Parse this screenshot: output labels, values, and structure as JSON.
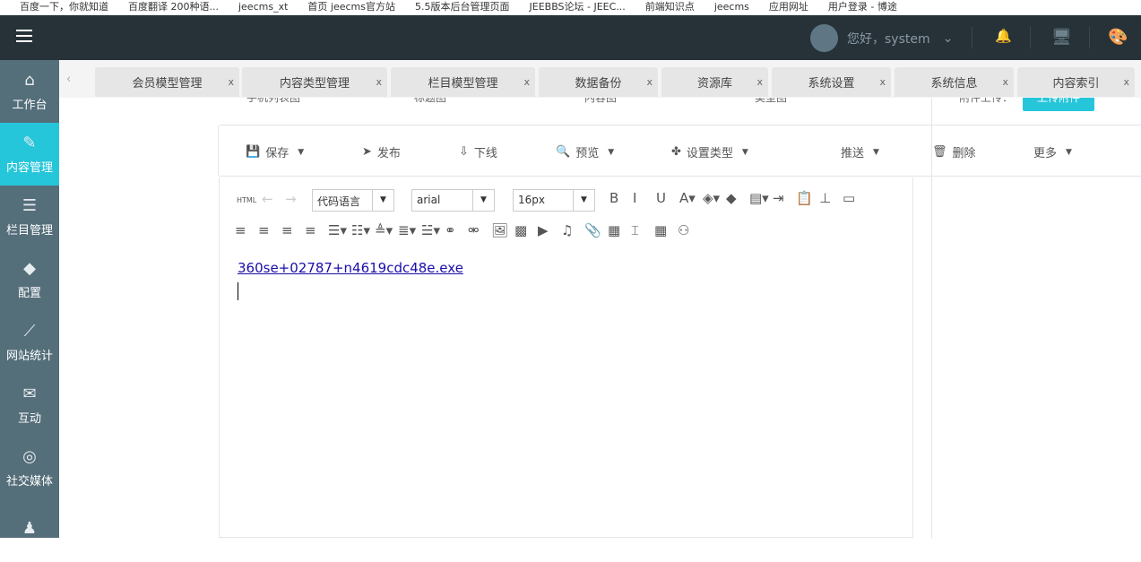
{
  "bookmarks": [
    "百度一下，你就知道",
    "百度翻译 200种语...",
    "jeecms_xt",
    "首页 jeecms官方站",
    "5.5版本后台管理页面",
    "JEEBBS论坛 - JEEC...",
    "前端知识点",
    "jeecms",
    "应用网址",
    "用户登录 - 博途"
  ],
  "header": {
    "greeting": "您好，system"
  },
  "sidebar": [
    {
      "label": "工作台",
      "icon": "⌂"
    },
    {
      "label": "内容管理",
      "icon": "✎"
    },
    {
      "label": "栏目管理",
      "icon": "☰"
    },
    {
      "label": "配置",
      "icon": "◆"
    },
    {
      "label": "网站统计",
      "icon": "⟋"
    },
    {
      "label": "互动",
      "icon": "✉"
    },
    {
      "label": "社交媒体",
      "icon": "◎"
    },
    {
      "label": "",
      "icon": "♟"
    }
  ],
  "tabs": [
    "会员模型管理",
    "内容类型管理",
    "栏目模型管理",
    "数据备份",
    "资源库",
    "系统设置",
    "系统信息",
    "内容索引"
  ],
  "tab_close": "x",
  "behind": {
    "labels": [
      "手机列表图",
      "标题图",
      "内容图",
      "类型图"
    ],
    "upload_label": "附件上传：",
    "upload_button": "上传附件"
  },
  "actions": [
    {
      "label": "保存",
      "icon": "💾",
      "dd": true
    },
    {
      "label": "发布",
      "icon": "➤",
      "dd": false
    },
    {
      "label": "下线",
      "icon": "⇩",
      "dd": false
    },
    {
      "label": "预览",
      "icon": "🔍",
      "dd": true
    },
    {
      "label": "设置类型",
      "icon": "✤",
      "dd": true
    },
    {
      "label": "推送",
      "icon": "",
      "dd": true
    },
    {
      "label": "删除",
      "icon": "🗑",
      "dd": false
    },
    {
      "label": "更多",
      "icon": "",
      "dd": true
    }
  ],
  "editor": {
    "html_label": "HTML",
    "code_lang": "代码语言",
    "font": "arial",
    "size": "16px",
    "content_link": "360se+02787+n4619cdc48e.exe"
  }
}
